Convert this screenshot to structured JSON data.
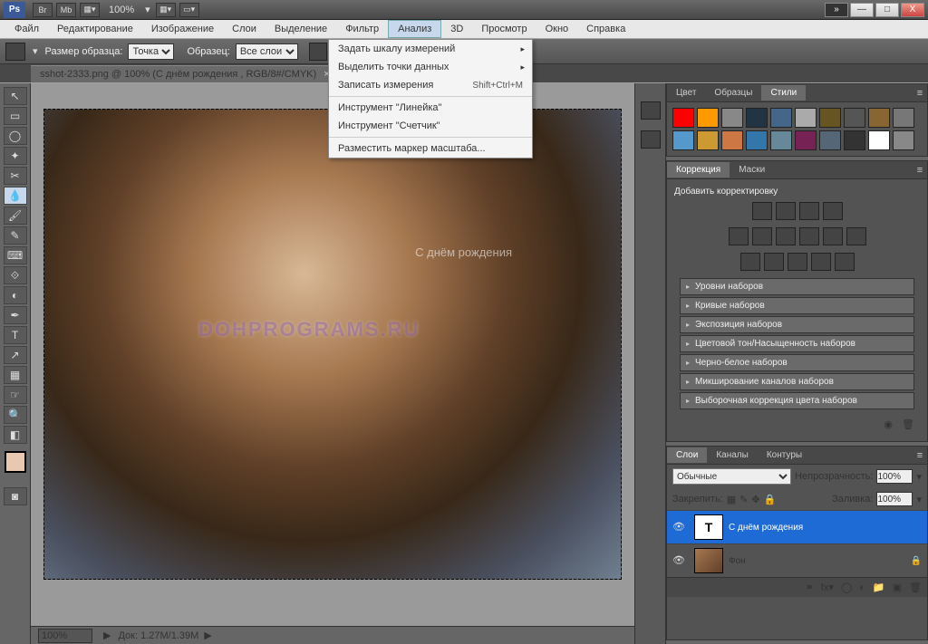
{
  "titlebar": {
    "app": "Ps",
    "zoom": "100%"
  },
  "winbuttons": {
    "expand": "»",
    "min": "—",
    "max": "□",
    "close": "X"
  },
  "menubar": [
    "Файл",
    "Редактирование",
    "Изображение",
    "Слои",
    "Выделение",
    "Фильтр",
    "Анализ",
    "3D",
    "Просмотр",
    "Окно",
    "Справка"
  ],
  "active_menu_index": 6,
  "dropdown": {
    "items": [
      {
        "label": "Задать шкалу измерений",
        "sub": true
      },
      {
        "label": "Выделить точки данных",
        "sub": true
      },
      {
        "label": "Записать измерения",
        "shortcut": "Shift+Ctrl+M"
      },
      {
        "sep": true
      },
      {
        "label": "Инструмент \"Линейка\""
      },
      {
        "label": "Инструмент \"Счетчик\""
      },
      {
        "sep": true
      },
      {
        "label": "Разместить маркер масштаба..."
      }
    ]
  },
  "optbar": {
    "sample_label": "Размер образца:",
    "sample_value": "Точка",
    "layers_label": "Образец:",
    "layers_value": "Все слои"
  },
  "doctab": {
    "title": "sshot-2333.png @ 100% (С днём рождения , RGB/8#/CMYK)",
    "close": "×"
  },
  "canvas": {
    "overlay_text": "С днём рождения",
    "watermark": "DOHPROGRAMS.RU"
  },
  "statusbar": {
    "zoom": "100%",
    "doc": "Док: 1.27M/1.39M",
    "arrow": "▶"
  },
  "tools": [
    "↖",
    "▭",
    "◯",
    "✦",
    "✂",
    "💧",
    "🖌",
    "✎",
    "⌨",
    "⟐",
    "◐",
    "✒",
    "T",
    "↗",
    "▦",
    "☞",
    "🔍",
    "◧"
  ],
  "panels": {
    "styles": {
      "tabs": [
        "Цвет",
        "Образцы",
        "Стили"
      ],
      "active": 2,
      "swatches": [
        "#ff0000",
        "#ff9900",
        "#888",
        "#223344",
        "#446688",
        "#aaa",
        "#665522",
        "#555",
        "#886633",
        "#777",
        "#5599cc",
        "#cc9933",
        "#cc7744",
        "#3377aa",
        "#668899",
        "#772255",
        "#556677",
        "#333",
        "#fff",
        "#888"
      ]
    },
    "correction": {
      "tabs": [
        "Коррекция",
        "Маски"
      ],
      "active": 0,
      "header": "Добавить корректировку",
      "presets": [
        "Уровни наборов",
        "Кривые наборов",
        "Экспозиция наборов",
        "Цветовой тон/Насыщенность наборов",
        "Черно-белое наборов",
        "Микширование каналов наборов",
        "Выборочная коррекция цвета наборов"
      ]
    },
    "layers": {
      "tabs": [
        "Слои",
        "Каналы",
        "Контуры"
      ],
      "active": 0,
      "blend_label": "",
      "blend": "Обычные",
      "opacity_label": "Непрозрачность:",
      "opacity": "100%",
      "lock_label": "Закрепить:",
      "fill_label": "Заливка:",
      "fill": "100%",
      "rows": [
        {
          "name": "С днём рождения",
          "type": "T",
          "selected": true
        },
        {
          "name": "Фон",
          "type": "img",
          "locked": true
        }
      ]
    }
  }
}
